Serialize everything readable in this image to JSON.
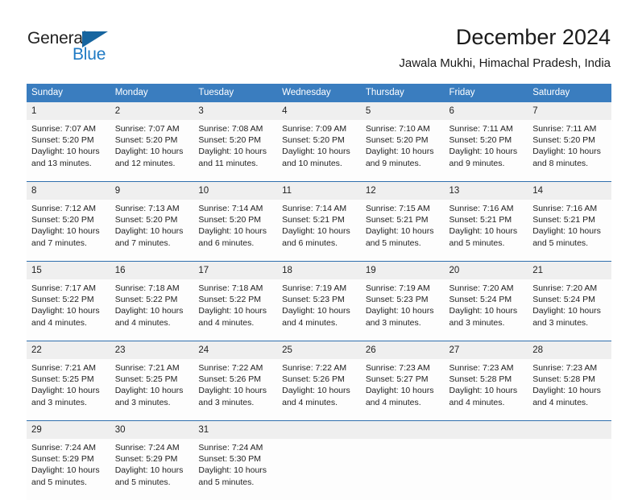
{
  "brand": {
    "name_part1": "General",
    "name_part2": "Blue",
    "triangle_icon": "triangle-icon",
    "color_dark": "#222222",
    "color_blue": "#1f7ac4"
  },
  "header": {
    "title": "December 2024",
    "subtitle": "Jawala Mukhi, Himachal Pradesh, India"
  },
  "theme": {
    "header_blue": "#3a7dbf",
    "row_divider_blue": "#2f6fad",
    "daynum_band": "#efefef"
  },
  "calendar": {
    "weekday_headers": [
      "Sunday",
      "Monday",
      "Tuesday",
      "Wednesday",
      "Thursday",
      "Friday",
      "Saturday"
    ],
    "weeks": [
      [
        {
          "day": "1",
          "sunrise": "Sunrise: 7:07 AM",
          "sunset": "Sunset: 5:20 PM",
          "daylight": "Daylight: 10 hours and 13 minutes."
        },
        {
          "day": "2",
          "sunrise": "Sunrise: 7:07 AM",
          "sunset": "Sunset: 5:20 PM",
          "daylight": "Daylight: 10 hours and 12 minutes."
        },
        {
          "day": "3",
          "sunrise": "Sunrise: 7:08 AM",
          "sunset": "Sunset: 5:20 PM",
          "daylight": "Daylight: 10 hours and 11 minutes."
        },
        {
          "day": "4",
          "sunrise": "Sunrise: 7:09 AM",
          "sunset": "Sunset: 5:20 PM",
          "daylight": "Daylight: 10 hours and 10 minutes."
        },
        {
          "day": "5",
          "sunrise": "Sunrise: 7:10 AM",
          "sunset": "Sunset: 5:20 PM",
          "daylight": "Daylight: 10 hours and 9 minutes."
        },
        {
          "day": "6",
          "sunrise": "Sunrise: 7:11 AM",
          "sunset": "Sunset: 5:20 PM",
          "daylight": "Daylight: 10 hours and 9 minutes."
        },
        {
          "day": "7",
          "sunrise": "Sunrise: 7:11 AM",
          "sunset": "Sunset: 5:20 PM",
          "daylight": "Daylight: 10 hours and 8 minutes."
        }
      ],
      [
        {
          "day": "8",
          "sunrise": "Sunrise: 7:12 AM",
          "sunset": "Sunset: 5:20 PM",
          "daylight": "Daylight: 10 hours and 7 minutes."
        },
        {
          "day": "9",
          "sunrise": "Sunrise: 7:13 AM",
          "sunset": "Sunset: 5:20 PM",
          "daylight": "Daylight: 10 hours and 7 minutes."
        },
        {
          "day": "10",
          "sunrise": "Sunrise: 7:14 AM",
          "sunset": "Sunset: 5:20 PM",
          "daylight": "Daylight: 10 hours and 6 minutes."
        },
        {
          "day": "11",
          "sunrise": "Sunrise: 7:14 AM",
          "sunset": "Sunset: 5:21 PM",
          "daylight": "Daylight: 10 hours and 6 minutes."
        },
        {
          "day": "12",
          "sunrise": "Sunrise: 7:15 AM",
          "sunset": "Sunset: 5:21 PM",
          "daylight": "Daylight: 10 hours and 5 minutes."
        },
        {
          "day": "13",
          "sunrise": "Sunrise: 7:16 AM",
          "sunset": "Sunset: 5:21 PM",
          "daylight": "Daylight: 10 hours and 5 minutes."
        },
        {
          "day": "14",
          "sunrise": "Sunrise: 7:16 AM",
          "sunset": "Sunset: 5:21 PM",
          "daylight": "Daylight: 10 hours and 5 minutes."
        }
      ],
      [
        {
          "day": "15",
          "sunrise": "Sunrise: 7:17 AM",
          "sunset": "Sunset: 5:22 PM",
          "daylight": "Daylight: 10 hours and 4 minutes."
        },
        {
          "day": "16",
          "sunrise": "Sunrise: 7:18 AM",
          "sunset": "Sunset: 5:22 PM",
          "daylight": "Daylight: 10 hours and 4 minutes."
        },
        {
          "day": "17",
          "sunrise": "Sunrise: 7:18 AM",
          "sunset": "Sunset: 5:22 PM",
          "daylight": "Daylight: 10 hours and 4 minutes."
        },
        {
          "day": "18",
          "sunrise": "Sunrise: 7:19 AM",
          "sunset": "Sunset: 5:23 PM",
          "daylight": "Daylight: 10 hours and 4 minutes."
        },
        {
          "day": "19",
          "sunrise": "Sunrise: 7:19 AM",
          "sunset": "Sunset: 5:23 PM",
          "daylight": "Daylight: 10 hours and 3 minutes."
        },
        {
          "day": "20",
          "sunrise": "Sunrise: 7:20 AM",
          "sunset": "Sunset: 5:24 PM",
          "daylight": "Daylight: 10 hours and 3 minutes."
        },
        {
          "day": "21",
          "sunrise": "Sunrise: 7:20 AM",
          "sunset": "Sunset: 5:24 PM",
          "daylight": "Daylight: 10 hours and 3 minutes."
        }
      ],
      [
        {
          "day": "22",
          "sunrise": "Sunrise: 7:21 AM",
          "sunset": "Sunset: 5:25 PM",
          "daylight": "Daylight: 10 hours and 3 minutes."
        },
        {
          "day": "23",
          "sunrise": "Sunrise: 7:21 AM",
          "sunset": "Sunset: 5:25 PM",
          "daylight": "Daylight: 10 hours and 3 minutes."
        },
        {
          "day": "24",
          "sunrise": "Sunrise: 7:22 AM",
          "sunset": "Sunset: 5:26 PM",
          "daylight": "Daylight: 10 hours and 3 minutes."
        },
        {
          "day": "25",
          "sunrise": "Sunrise: 7:22 AM",
          "sunset": "Sunset: 5:26 PM",
          "daylight": "Daylight: 10 hours and 4 minutes."
        },
        {
          "day": "26",
          "sunrise": "Sunrise: 7:23 AM",
          "sunset": "Sunset: 5:27 PM",
          "daylight": "Daylight: 10 hours and 4 minutes."
        },
        {
          "day": "27",
          "sunrise": "Sunrise: 7:23 AM",
          "sunset": "Sunset: 5:28 PM",
          "daylight": "Daylight: 10 hours and 4 minutes."
        },
        {
          "day": "28",
          "sunrise": "Sunrise: 7:23 AM",
          "sunset": "Sunset: 5:28 PM",
          "daylight": "Daylight: 10 hours and 4 minutes."
        }
      ],
      [
        {
          "day": "29",
          "sunrise": "Sunrise: 7:24 AM",
          "sunset": "Sunset: 5:29 PM",
          "daylight": "Daylight: 10 hours and 5 minutes."
        },
        {
          "day": "30",
          "sunrise": "Sunrise: 7:24 AM",
          "sunset": "Sunset: 5:29 PM",
          "daylight": "Daylight: 10 hours and 5 minutes."
        },
        {
          "day": "31",
          "sunrise": "Sunrise: 7:24 AM",
          "sunset": "Sunset: 5:30 PM",
          "daylight": "Daylight: 10 hours and 5 minutes."
        },
        {
          "day": "",
          "sunrise": "",
          "sunset": "",
          "daylight": ""
        },
        {
          "day": "",
          "sunrise": "",
          "sunset": "",
          "daylight": ""
        },
        {
          "day": "",
          "sunrise": "",
          "sunset": "",
          "daylight": ""
        },
        {
          "day": "",
          "sunrise": "",
          "sunset": "",
          "daylight": ""
        }
      ]
    ]
  }
}
